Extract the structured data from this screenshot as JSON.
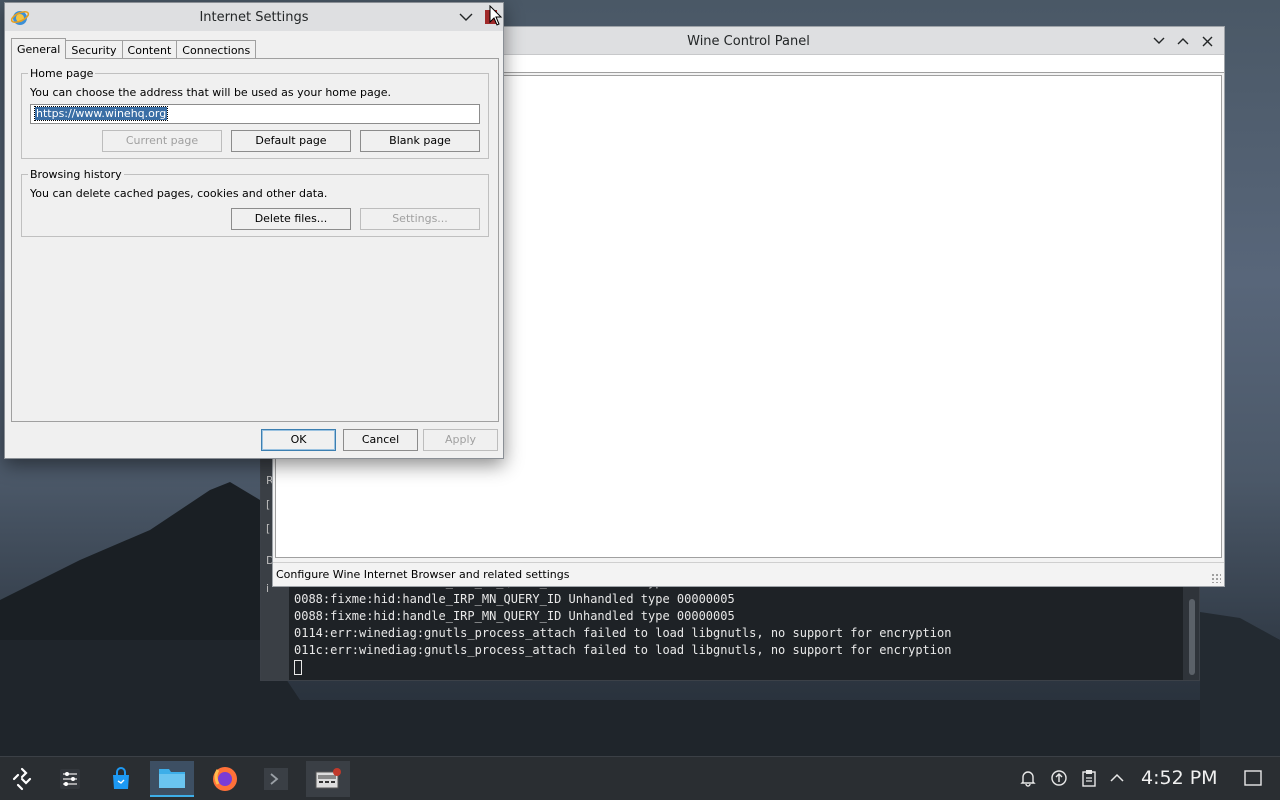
{
  "terminal": {
    "side_labels": [
      "R",
      "[",
      "[",
      "D",
      "i"
    ],
    "lines": [
      "0088:fixme:hid:handle_IRP_MN_QUERY_ID Unhandled type 00000005",
      "0088:fixme:hid:handle_IRP_MN_QUERY_ID Unhandled type 00000005",
      "0114:err:winediag:gnutls_process_attach failed to load libgnutls, no support for encryption",
      "011c:err:winediag:gnutls_process_attach failed to load libgnutls, no support for encryption"
    ]
  },
  "control_panel": {
    "title": "Wine Control Panel",
    "status": "Configure Wine Internet Browser and related settings"
  },
  "dialog": {
    "title": "Internet Settings",
    "tabs": [
      {
        "label": "General",
        "active": true
      },
      {
        "label": "Security",
        "active": false
      },
      {
        "label": "Content",
        "active": false
      },
      {
        "label": "Connections",
        "active": false
      }
    ],
    "home_page": {
      "title": "Home page",
      "description": "You can choose the address that will be used as your home page.",
      "address": "https://www.winehq.org",
      "current_page": "Current page",
      "default_page": "Default page",
      "blank_page": "Blank page"
    },
    "browsing_history": {
      "title": "Browsing history",
      "description": "You can delete cached pages, cookies and other data.",
      "delete_files": "Delete files...",
      "settings": "Settings..."
    },
    "ok": "OK",
    "cancel": "Cancel",
    "apply": "Apply"
  },
  "taskbar": {
    "clock": "4:52 PM",
    "accent": "#3daee9"
  }
}
